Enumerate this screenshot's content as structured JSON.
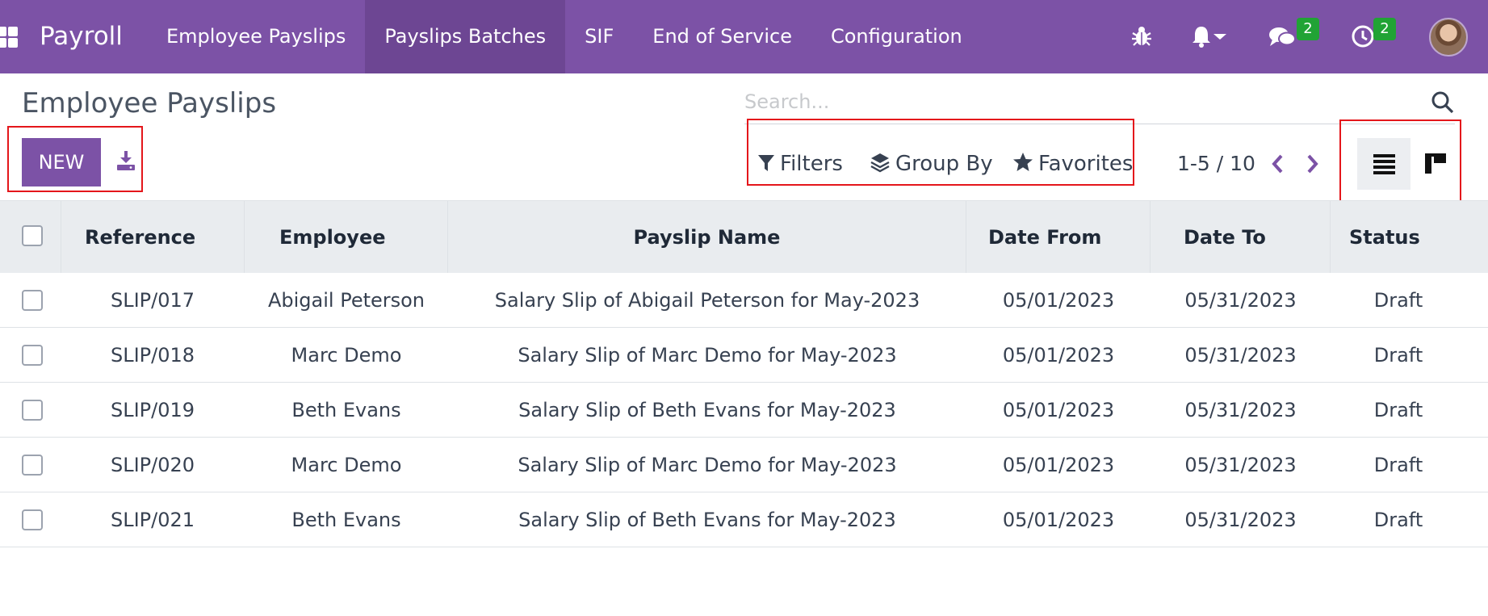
{
  "navbar": {
    "brand": "Payroll",
    "menu": [
      {
        "label": "Employee Payslips",
        "active": false
      },
      {
        "label": "Payslips Batches",
        "active": true
      },
      {
        "label": "SIF",
        "active": false
      },
      {
        "label": "End of Service",
        "active": false
      },
      {
        "label": "Configuration",
        "active": false
      }
    ],
    "messages_badge": "2",
    "activities_badge": "2",
    "icons": [
      "apps-icon",
      "bug-icon",
      "bell-icon",
      "chat-icon",
      "clock-icon"
    ]
  },
  "control": {
    "title": "Employee Payslips",
    "new_label": "NEW",
    "search_placeholder": "Search...",
    "filters_label": "Filters",
    "groupby_label": "Group By",
    "favorites_label": "Favorites",
    "pager": "1-5 / 10"
  },
  "colors": {
    "brand": "#7c52a6",
    "active_menu": "#6d4693",
    "badge": "#21a335",
    "highlight": "#e4161b"
  },
  "table": {
    "columns": [
      "Reference",
      "Employee",
      "Payslip Name",
      "Date From",
      "Date To",
      "Status"
    ],
    "rows": [
      {
        "ref": "SLIP/017",
        "employee": "Abigail Peterson",
        "name": "Salary Slip of Abigail Peterson for May-2023",
        "from": "05/01/2023",
        "to": "05/31/2023",
        "status": "Draft"
      },
      {
        "ref": "SLIP/018",
        "employee": "Marc Demo",
        "name": "Salary Slip of Marc Demo for May-2023",
        "from": "05/01/2023",
        "to": "05/31/2023",
        "status": "Draft"
      },
      {
        "ref": "SLIP/019",
        "employee": "Beth Evans",
        "name": "Salary Slip of Beth Evans for May-2023",
        "from": "05/01/2023",
        "to": "05/31/2023",
        "status": "Draft"
      },
      {
        "ref": "SLIP/020",
        "employee": "Marc Demo",
        "name": "Salary Slip of Marc Demo for May-2023",
        "from": "05/01/2023",
        "to": "05/31/2023",
        "status": "Draft"
      },
      {
        "ref": "SLIP/021",
        "employee": "Beth Evans",
        "name": "Salary Slip of Beth Evans for May-2023",
        "from": "05/01/2023",
        "to": "05/31/2023",
        "status": "Draft"
      }
    ]
  }
}
